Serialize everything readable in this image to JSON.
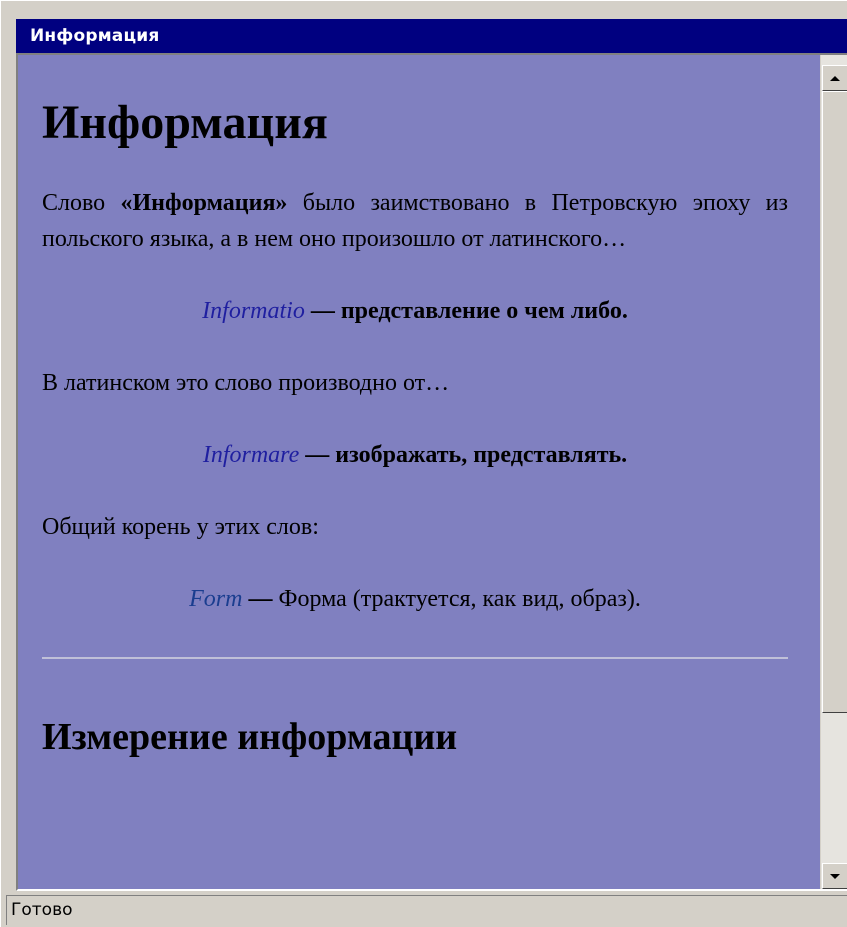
{
  "window": {
    "title": "Информация"
  },
  "document": {
    "heading": "Информация",
    "intro": {
      "before": "Слово ",
      "bold": "«Информация»",
      "after": " было заимствовано в Петровскую эпоху из польского языка, а в нем оно произошло от латинского…"
    },
    "definitions": [
      {
        "term": "Informatio",
        "dash": " — ",
        "meaning": "представление о чем либо.",
        "meaning_bold": true
      },
      {
        "term": "Informare",
        "dash": " — ",
        "meaning": "изображать, представлять.",
        "meaning_bold": true
      },
      {
        "term": "Form",
        "dash": " — ",
        "meaning": "Форма (трактуется, как вид, образ).",
        "meaning_bold": false
      }
    ],
    "para_latin": "В латинском это слово производно от…",
    "para_root": "Общий корень у этих слов:",
    "section_heading": "Измерение информации"
  },
  "status": {
    "text": "Готово"
  },
  "colors": {
    "titlebar": "#000080",
    "content_background": "#8080c0",
    "chrome": "#d4d0c8",
    "term_link": "#1f1fa0"
  },
  "icons": {
    "scroll_up": "arrow-up",
    "scroll_down": "arrow-down"
  }
}
